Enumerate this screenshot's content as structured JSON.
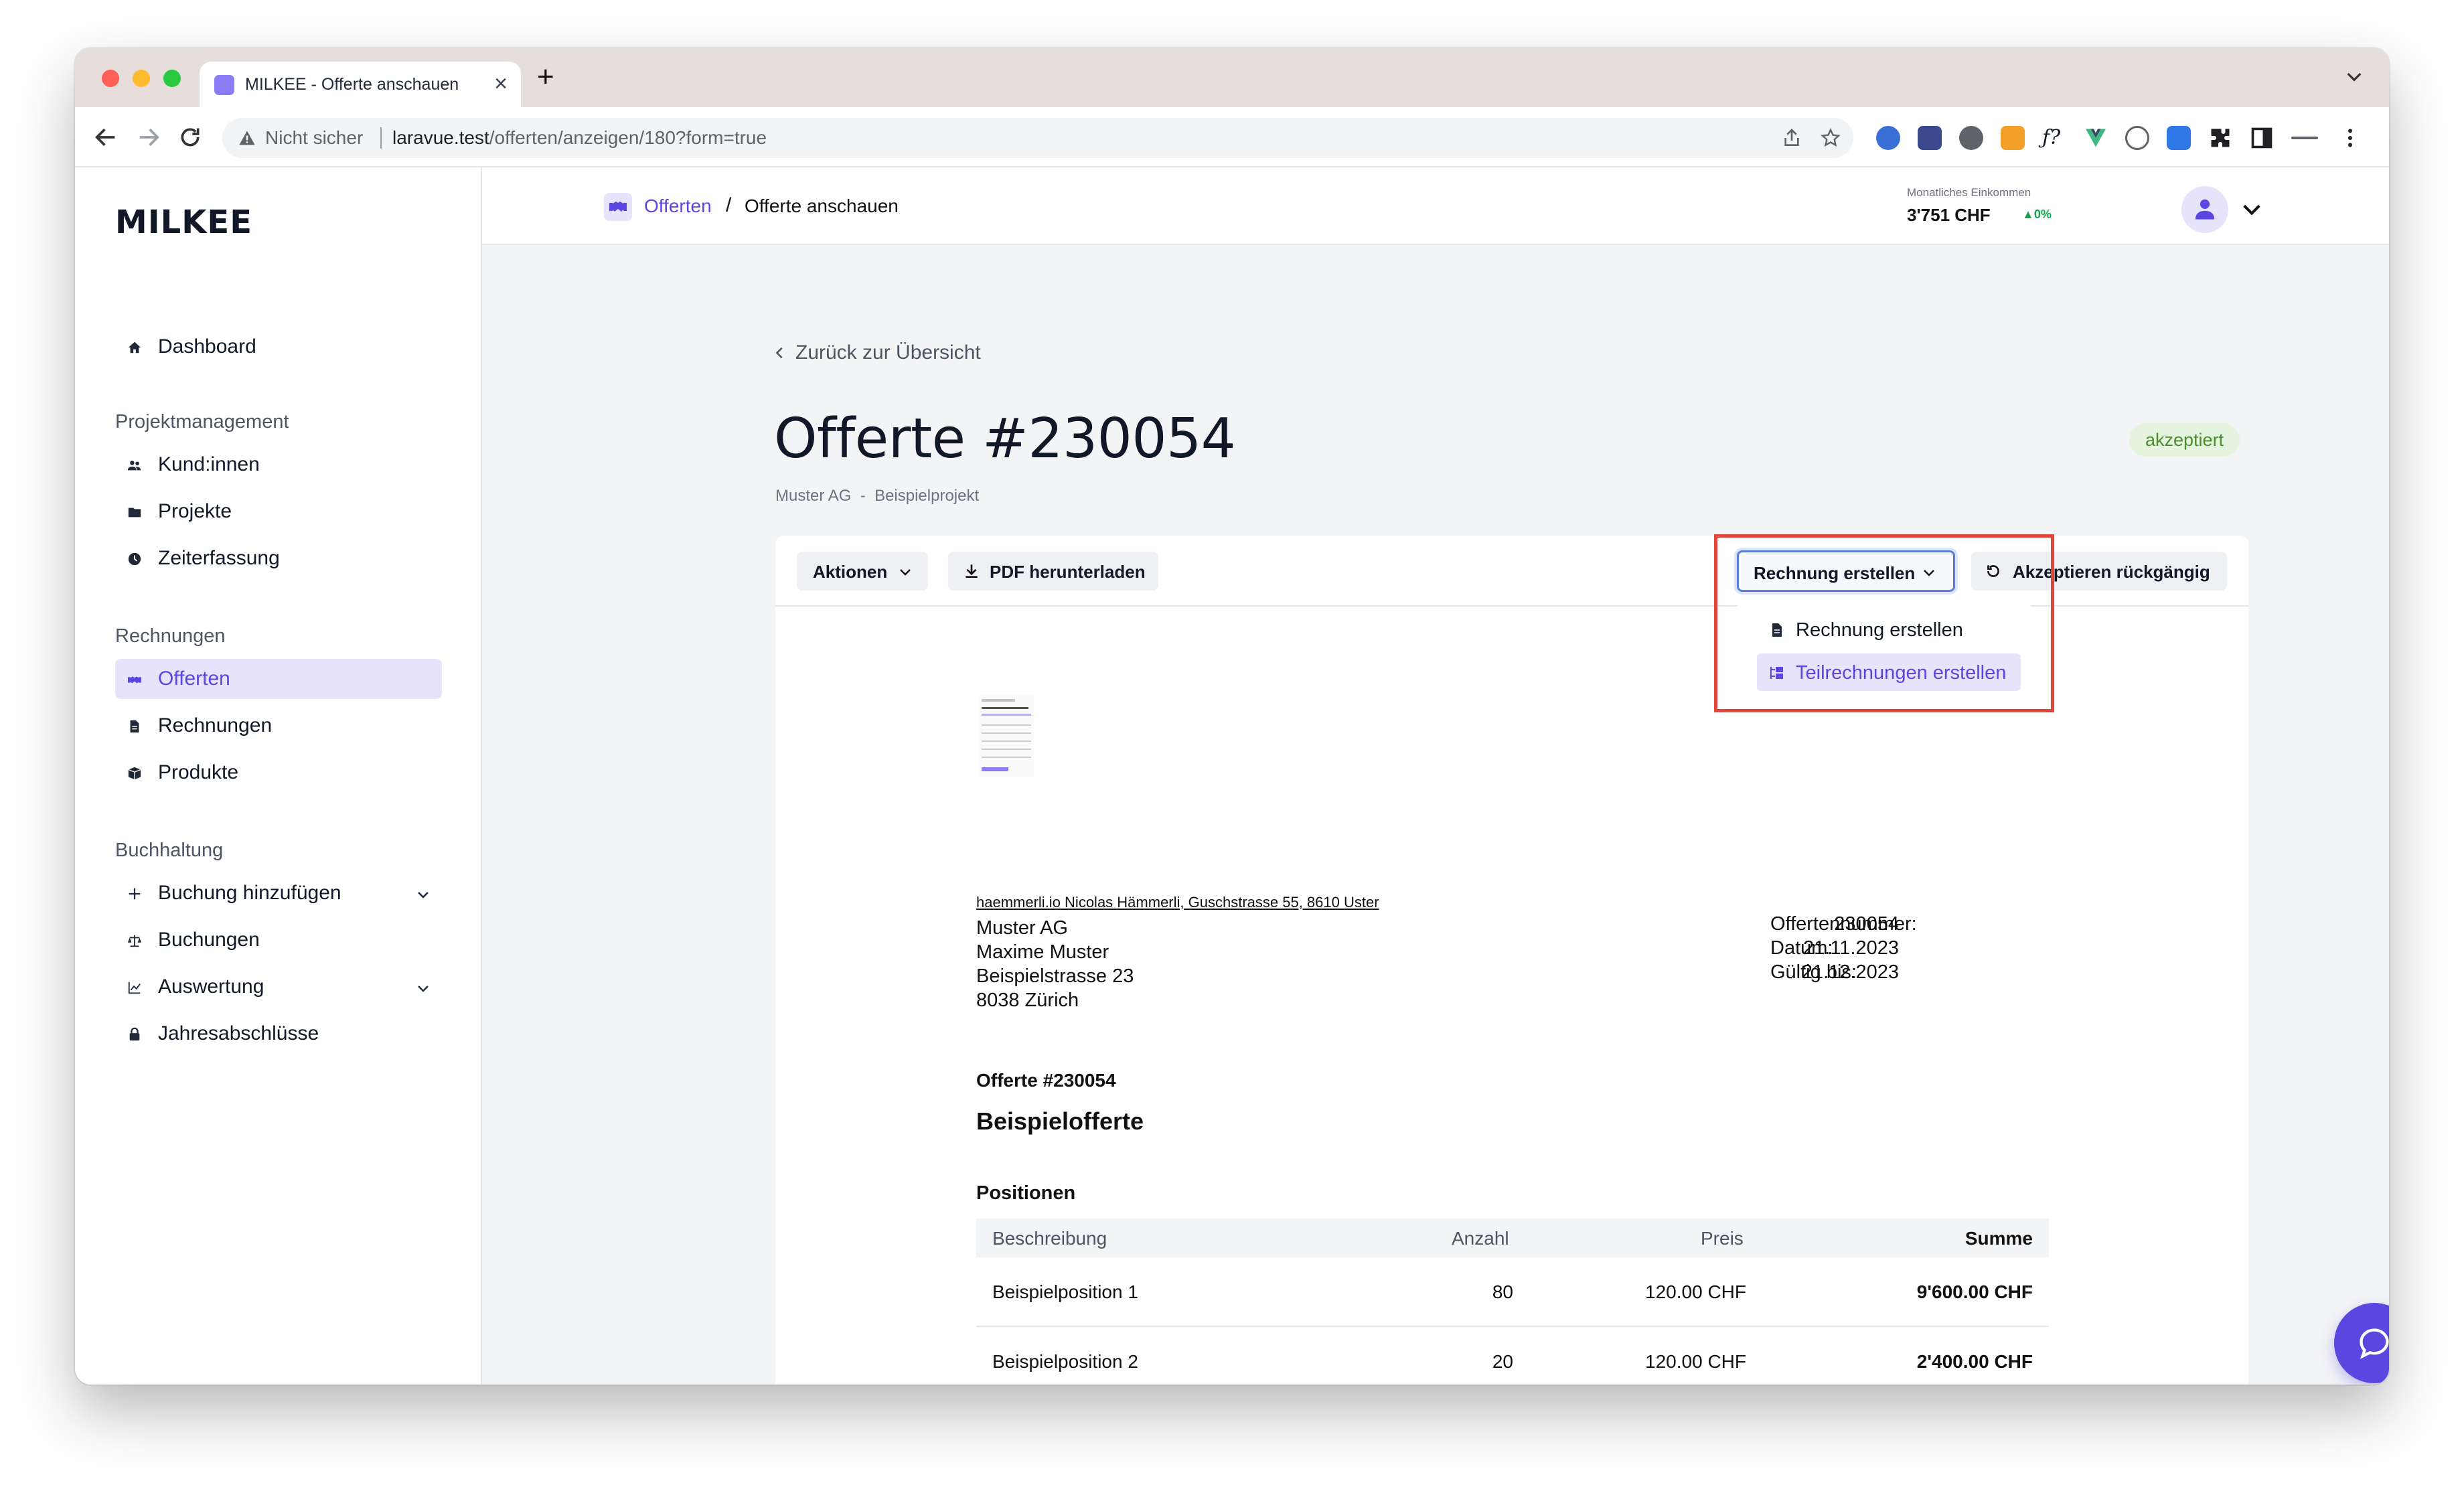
{
  "browser": {
    "tab_title": "MILKEE - Offerte anschauen",
    "security_label": "Nicht sicher",
    "url_host": "laravue.test",
    "url_path": "/offerten/anzeigen/180?form=true"
  },
  "sidebar": {
    "logo": "MILKEE",
    "dashboard": "Dashboard",
    "section_projects": "Projektmanagement",
    "projects_items": [
      "Kund:innen",
      "Projekte",
      "Zeiterfassung"
    ],
    "section_invoices": "Rechnungen",
    "invoice_items": [
      "Offerten",
      "Rechnungen",
      "Produkte"
    ],
    "section_accounting": "Buchhaltung",
    "accounting_items": [
      "Buchung hinzufügen",
      "Buchungen",
      "Auswertung",
      "Jahresabschlüsse"
    ]
  },
  "header": {
    "breadcrumb_link": "Offerten",
    "breadcrumb_sep": "/",
    "breadcrumb_current": "Offerte anschauen",
    "income_label": "Monatliches Einkommen",
    "income_value": "3'751 CHF",
    "income_change": "0%"
  },
  "main": {
    "back_label": "Zurück zur Übersicht",
    "title": "Offerte #230054",
    "customer": "Muster AG",
    "sub_sep": "-",
    "project": "Beispielprojekt",
    "status_badge": "akzeptiert",
    "actions_label": "Aktionen",
    "pdf_label": "PDF herunterladen",
    "create_invoice_label": "Rechnung erstellen",
    "undo_accept_label": "Akzeptieren rückgängig"
  },
  "dropdown": {
    "items": [
      "Rechnung erstellen",
      "Teilrechnungen erstellen"
    ],
    "highlighted_index": 1
  },
  "document": {
    "sender_line": "haemmerli.io Nicolas Hämmerli, Guschstrasse 55, 8610 Uster",
    "recipient": [
      "Muster AG",
      "Maxime Muster",
      "Beispielstrasse 23",
      "8038 Zürich"
    ],
    "meta_labels": [
      "Offertennummer:",
      "Datum:",
      "Gültig bis:"
    ],
    "meta_values": [
      "230054",
      "21.11.2023",
      "21.12.2023"
    ],
    "number_heading": "Offerte #230054",
    "title": "Beispielofferte",
    "positions_heading": "Positionen",
    "table_headers": [
      "Beschreibung",
      "Anzahl",
      "Preis",
      "Summe"
    ],
    "rows": [
      {
        "desc": "Beispielposition 1",
        "qty": "80",
        "price": "120.00 CHF",
        "sum": "9'600.00 CHF"
      },
      {
        "desc": "Beispielposition 2",
        "qty": "20",
        "price": "120.00 CHF",
        "sum": "2'400.00 CHF"
      }
    ]
  },
  "colors": {
    "accent": "#5b47e0",
    "accent_light": "#e6e3fb",
    "badge_bg": "#e4f4de",
    "badge_text": "#4d8c2f",
    "highlight": "#e0453a"
  }
}
